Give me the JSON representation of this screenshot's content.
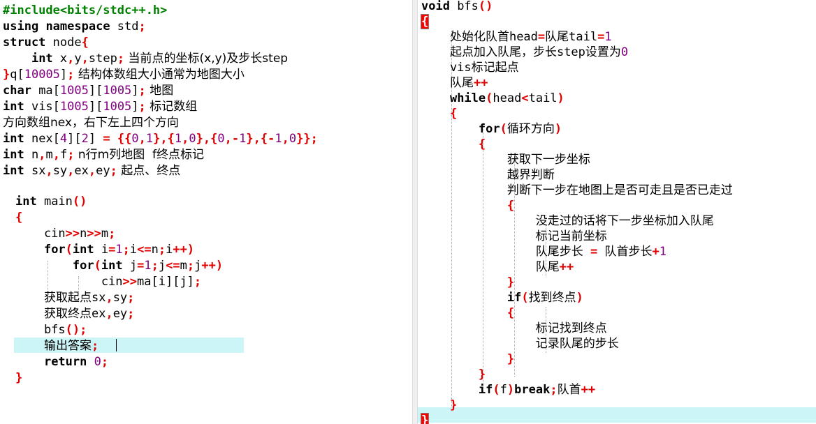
{
  "left": {
    "header": [
      {
        "code": "#include<bits/stdc++.h>"
      },
      {
        "code": "using namespace std;"
      },
      {
        "code": "struct node{"
      },
      {
        "code": "    int x,y,step;",
        "comment": " 当前点的坐标(x,y)及步长step"
      },
      {
        "code": "}q[10005];",
        "comment": " 结构体数组大小通常为地图大小"
      },
      {
        "code": "char ma[1005][1005];",
        "comment": " 地图"
      },
      {
        "code": "int vis[1005][1005];",
        "comment": " 标记数组"
      },
      {
        "code": "",
        "comment": "方向数组nex，右下左上四个方向"
      },
      {
        "code": "int nex[4][2] = {{0,1},{1,0},{0,-1},{-1,0}};"
      },
      {
        "code": "int n,m,f;",
        "comment": " n行m列地图  f终点标记"
      },
      {
        "code": "int sx,sy,ex,ey;",
        "comment": " 起点、终点"
      }
    ],
    "main": [
      {
        "code": "int main()"
      },
      {
        "code": "{"
      },
      {
        "code": "    cin>>n>>m;"
      },
      {
        "code": "    for(int i=1;i<=n;i++)"
      },
      {
        "code": "        for(int j=1;j<=m;j++)"
      },
      {
        "code": "            cin>>ma[i][j];"
      },
      {
        "code": "    获取起点sx,sy;"
      },
      {
        "code": "    获取终点ex,ey;"
      },
      {
        "code": "    bfs();"
      },
      {
        "code": "    输出答案;"
      },
      {
        "code": "    return 0;"
      },
      {
        "code": "}"
      }
    ]
  },
  "right": {
    "lines": [
      {
        "code": "void bfs()"
      },
      {
        "code": "{"
      },
      {
        "code": "    处始化队首head=队尾tail=1"
      },
      {
        "code": "    起点加入队尾，步长step设置为0"
      },
      {
        "code": "    vis标记起点"
      },
      {
        "code": "    队尾++"
      },
      {
        "code": "    while(head<tail)"
      },
      {
        "code": "    {"
      },
      {
        "code": "        for(循环方向)"
      },
      {
        "code": "        {"
      },
      {
        "code": "            获取下一步坐标"
      },
      {
        "code": "            越界判断"
      },
      {
        "code": "            判断下一步在地图上是否可走且是否已走过"
      },
      {
        "code": "            {"
      },
      {
        "code": "                没走过的话将下一步坐标加入队尾"
      },
      {
        "code": "                标记当前坐标"
      },
      {
        "code": "                队尾步长 = 队首步长+1"
      },
      {
        "code": "                队尾++"
      },
      {
        "code": "            }"
      },
      {
        "code": "            if(找到终点)"
      },
      {
        "code": "            {"
      },
      {
        "code": "                标记找到终点"
      },
      {
        "code": "                记录队尾的步长"
      },
      {
        "code": "            }"
      },
      {
        "code": "        }"
      },
      {
        "code": "        if(f)break;队首++"
      },
      {
        "code": "    }"
      },
      {
        "code": "}"
      }
    ]
  },
  "colors": {
    "keyword": "#000000",
    "preprocessor": "#008000",
    "number": "#800080",
    "operator": "#e00000",
    "current_line": "#ccf5f7",
    "brace_match": "#ff0000"
  }
}
